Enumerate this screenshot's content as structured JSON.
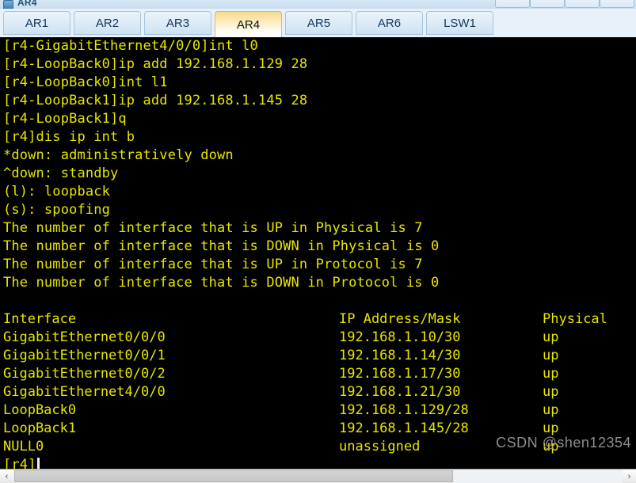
{
  "window": {
    "title": "AR4",
    "icon": "router-icon",
    "buttons": [
      {
        "name": "minimize-button",
        "label": ""
      },
      {
        "name": "maximize-button",
        "label": ""
      },
      {
        "name": "restore-button",
        "label": ""
      },
      {
        "name": "close-button",
        "label": ""
      }
    ]
  },
  "tabs": {
    "items": [
      {
        "label": "AR1",
        "active": false
      },
      {
        "label": "AR2",
        "active": false
      },
      {
        "label": "AR3",
        "active": false
      },
      {
        "label": "AR4",
        "active": true
      },
      {
        "label": "AR5",
        "active": false
      },
      {
        "label": "AR6",
        "active": false
      },
      {
        "label": "LSW1",
        "active": false
      }
    ]
  },
  "terminal": {
    "foreground_color": "#e6e600",
    "background_color": "#000000",
    "lines": [
      "[r4-GigabitEthernet4/0/0]int l0",
      "[r4-LoopBack0]ip add 192.168.1.129 28",
      "[r4-LoopBack0]int l1",
      "[r4-LoopBack1]ip add 192.168.1.145 28",
      "[r4-LoopBack1]q",
      "[r4]dis ip int b",
      "*down: administratively down",
      "^down: standby",
      "(l): loopback",
      "(s): spoofing",
      "The number of interface that is UP in Physical is 7",
      "The number of interface that is DOWN in Physical is 0",
      "The number of interface that is UP in Protocol is 7",
      "The number of interface that is DOWN in Protocol is 0",
      ""
    ],
    "table": {
      "headers": [
        "Interface",
        "IP Address/Mask",
        "Physical"
      ],
      "rows": [
        [
          "GigabitEthernet0/0/0",
          "192.168.1.10/30",
          "up"
        ],
        [
          "GigabitEthernet0/0/1",
          "192.168.1.14/30",
          "up"
        ],
        [
          "GigabitEthernet0/0/2",
          "192.168.1.17/30",
          "up"
        ],
        [
          "GigabitEthernet4/0/0",
          "192.168.1.21/30",
          "up"
        ],
        [
          "LoopBack0",
          "192.168.1.129/28",
          "up"
        ],
        [
          "LoopBack1",
          "192.168.1.145/28",
          "up"
        ],
        [
          "NULL0",
          "unassigned",
          "up"
        ]
      ]
    },
    "prompt": "[r4]"
  },
  "watermark": {
    "text": "CSDN @shen12354"
  },
  "scrollbar": {
    "left_arrow": "‹",
    "right_arrow": "›"
  }
}
